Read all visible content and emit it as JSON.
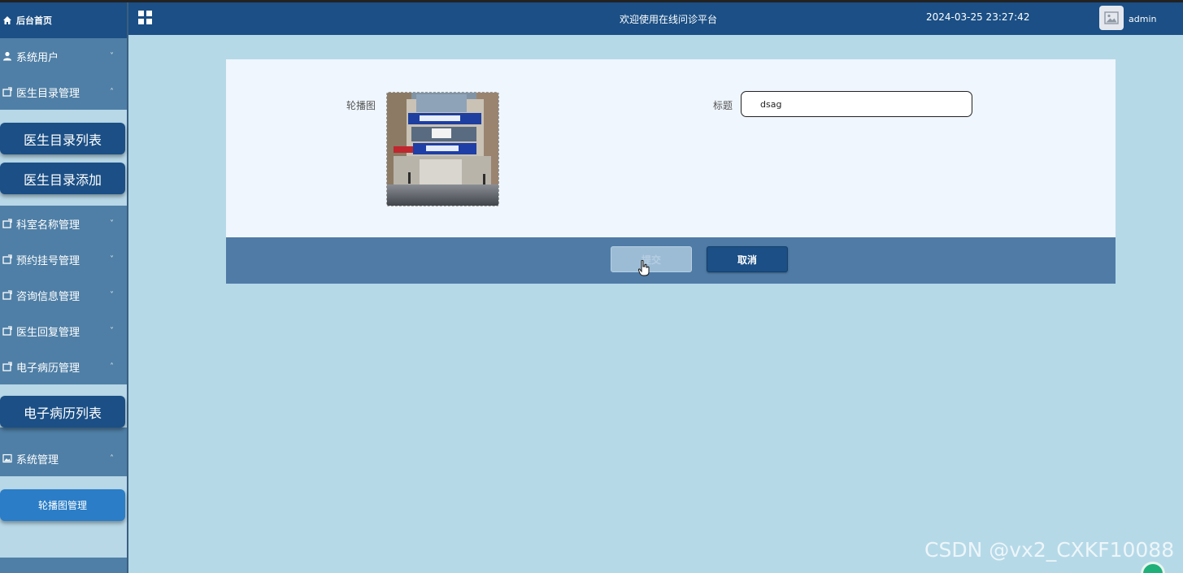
{
  "sidebar": {
    "home_label": "后台首页",
    "menus": [
      {
        "label": "系统用户",
        "chevron": "˅"
      },
      {
        "label": "医生目录管理",
        "chevron": "˄"
      },
      {
        "label": "科室名称管理",
        "chevron": "˅"
      },
      {
        "label": "预约挂号管理",
        "chevron": "˅"
      },
      {
        "label": "咨询信息管理",
        "chevron": "˅"
      },
      {
        "label": "医生回复管理",
        "chevron": "˅"
      },
      {
        "label": "电子病历管理",
        "chevron": "˄"
      },
      {
        "label": "系统管理",
        "chevron": "˄"
      }
    ],
    "doctor_sub": [
      "医生目录列表",
      "医生目录添加"
    ],
    "record_sub": [
      "电子病历列表"
    ],
    "system_sub": [
      "轮播图管理"
    ]
  },
  "header": {
    "welcome": "欢迎使用在线问诊平台",
    "datetime": "2024-03-25 23:27:42",
    "username": "admin"
  },
  "form": {
    "carousel_label": "轮播图",
    "title_label": "标题",
    "title_value": "dsag"
  },
  "actions": {
    "submit_label": "提交",
    "cancel_label": "取消"
  },
  "watermark": "CSDN @vx2_CXKF10088",
  "colors": {
    "primary": "#1b4f85",
    "sidebar": "#4f7fa6",
    "background": "#b6d9e8",
    "active_sub": "#2a7dc6"
  }
}
